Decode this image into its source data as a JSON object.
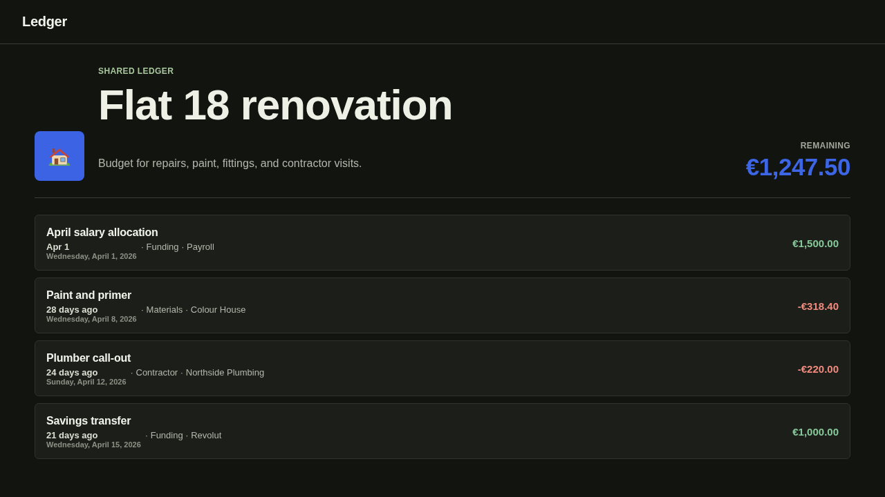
{
  "app": {
    "name": "Ledger"
  },
  "ledger": {
    "eyebrow": "SHARED LEDGER",
    "title": "Flat 18 renovation",
    "description": "Budget for repairs, paint, fittings, and contractor visits.",
    "balance": {
      "label": "REMAINING",
      "amount": "€1,247.50"
    }
  },
  "transactions": [
    {
      "title": "April salary allocation",
      "relative_date": "Apr 1",
      "full_date": "Wednesday, April 1, 2026",
      "details": "· Funding · Payroll",
      "amount": "€1,500.00",
      "kind": "credit"
    },
    {
      "title": "Paint and primer",
      "relative_date": "28 days ago",
      "full_date": "Wednesday, April 8, 2026",
      "details": "· Materials · Colour House",
      "amount": "-€318.40",
      "kind": "debit"
    },
    {
      "title": "Plumber call-out",
      "relative_date": "24 days ago",
      "full_date": "Sunday, April 12, 2026",
      "details": "· Contractor · Northside Plumbing",
      "amount": "-€220.00",
      "kind": "debit"
    },
    {
      "title": "Savings transfer",
      "relative_date": "21 days ago",
      "full_date": "Wednesday, April 15, 2026",
      "details": "· Funding · Revolut",
      "amount": "€1,000.00",
      "kind": "credit"
    }
  ]
}
